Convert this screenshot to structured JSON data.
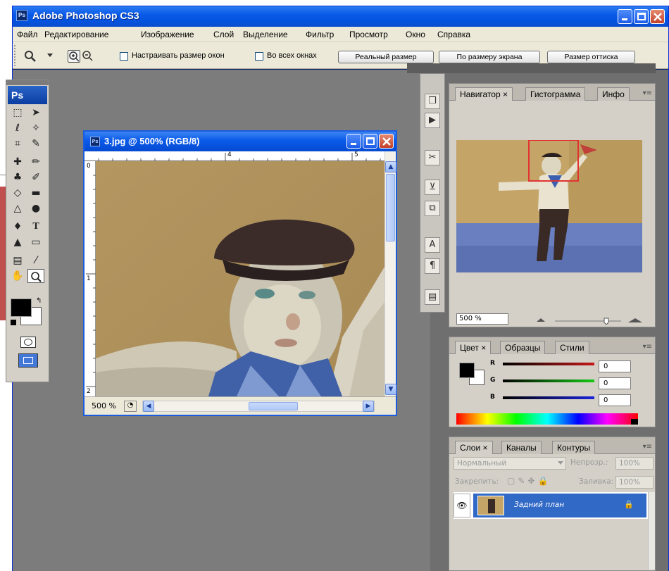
{
  "app": {
    "title": "Adobe Photoshop CS3",
    "icon_text": "Ps"
  },
  "menu": [
    "Файл",
    "Редактирование",
    "Изображение",
    "Слой",
    "Выделение",
    "Фильтр",
    "Просмотр",
    "Окно",
    "Справка"
  ],
  "options": {
    "resize_windows": "Настраивать размер окон",
    "all_windows": "Во всех окнах",
    "actual_size": "Реальный размер",
    "fit_screen": "По размеру экрана",
    "print_size": "Размер оттиска"
  },
  "toolbox": {
    "badge": "Ps"
  },
  "document": {
    "title": "3.jpg @ 500% (RGB/8)",
    "zoom": "500 %",
    "ruler_top": [
      "4",
      "5"
    ],
    "ruler_left": [
      "0",
      "1",
      "2"
    ]
  },
  "navigator": {
    "tabs": [
      "Навигатор ×",
      "Гистограмма",
      "Инфо"
    ],
    "zoom": "500 %"
  },
  "color": {
    "tabs": [
      "Цвет ×",
      "Образцы",
      "Стили"
    ],
    "channels": [
      {
        "label": "R",
        "value": "0"
      },
      {
        "label": "G",
        "value": "0"
      },
      {
        "label": "B",
        "value": "0"
      }
    ]
  },
  "layers": {
    "tabs": [
      "Слои ×",
      "Каналы",
      "Контуры"
    ],
    "blend_mode": "Нормальный",
    "opacity_label": "Непрозр.:",
    "opacity_value": "100%",
    "lock_label": "Закрепить:",
    "fill_label": "Заливка:",
    "fill_value": "100%",
    "layer_name": "Задний план"
  },
  "colors": {
    "title_blue": "#0a5ae8",
    "panel_gray": "#d4d0c8",
    "workspace_gray": "#7c7c7c",
    "selection_blue": "#3169c6"
  }
}
